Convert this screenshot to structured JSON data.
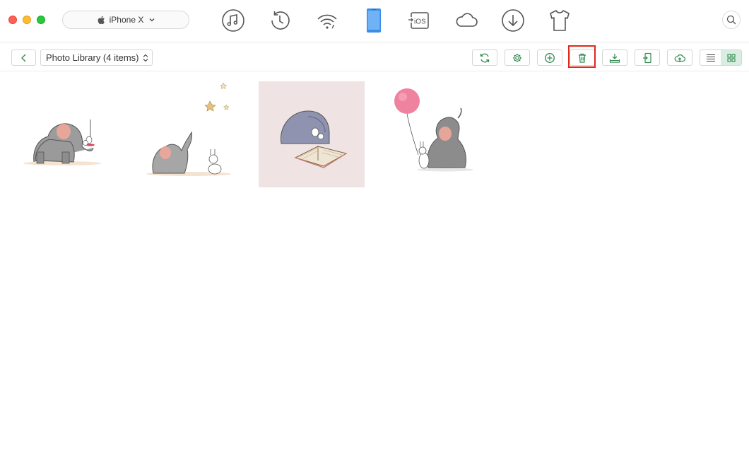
{
  "device": {
    "name": "iPhone X"
  },
  "top_nav": [
    {
      "name": "audio-icon"
    },
    {
      "name": "history-icon"
    },
    {
      "name": "wifi-sync-icon"
    },
    {
      "name": "iphone-icon",
      "active": true
    },
    {
      "name": "ios-mover-icon",
      "label": "iOS"
    },
    {
      "name": "icloud-icon"
    },
    {
      "name": "download-icon"
    },
    {
      "name": "ringtone-shirt-icon"
    }
  ],
  "toolbar": {
    "library_label": "Photo Library (4 items)",
    "buttons": [
      "refresh-icon",
      "settings-icon",
      "add-icon",
      "delete-icon",
      "export-to-computer-icon",
      "send-to-device-icon",
      "upload-cloud-icon"
    ],
    "highlighted_button": "delete-icon",
    "view_modes": [
      "list-view-icon",
      "grid-view-icon"
    ],
    "active_view": "grid-view-icon"
  },
  "photos": [
    {
      "name": "elephant-with-mouse",
      "selected": false
    },
    {
      "name": "elephant-with-bunny-and-stars",
      "selected": false
    },
    {
      "name": "elephant-reading-book",
      "selected": true
    },
    {
      "name": "elephant-with-balloon",
      "selected": false
    }
  ],
  "colors": {
    "accent_green": "#2f8a4e",
    "active_blue": "#3a8ee6",
    "highlight_red": "#e0281b",
    "selected_bg": "#efe3e3"
  }
}
